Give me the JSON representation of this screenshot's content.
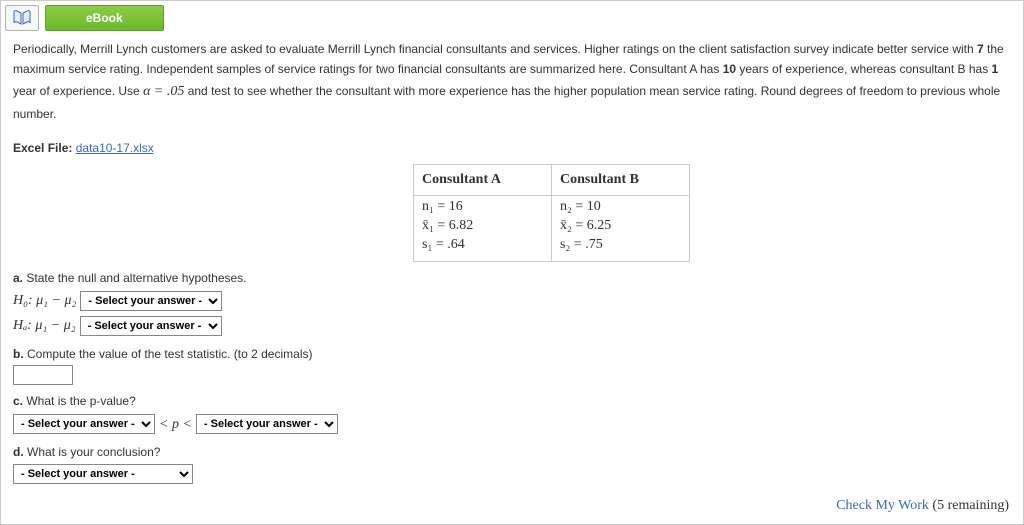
{
  "toolbar": {
    "ebook_label": "eBook"
  },
  "problem": {
    "text_parts": [
      "Periodically, Merrill Lynch customers are asked to evaluate Merrill Lynch financial consultants and services. Higher ratings on the client satisfaction survey indicate better service with ",
      "7",
      " the maximum service rating. Independent samples of service ratings for two financial consultants are summarized here. Consultant A has ",
      "10",
      " years of experience, whereas consultant B has ",
      "1",
      " year of experience. Use ",
      "α = .05",
      " and test to see whether the consultant with more experience has the higher population mean service rating. Round degrees of freedom to previous whole number."
    ],
    "file_label": "Excel File:",
    "file_name": "data10-17.xlsx"
  },
  "table": {
    "header_a": "Consultant A",
    "header_b": "Consultant B",
    "a_n": "n₁ = 16",
    "a_xbar": "x̄₁ = 6.82",
    "a_s": "s₁ = .64",
    "b_n": "n₂ = 10",
    "b_xbar": "x̄₂ = 6.25",
    "b_s": "s₂ = .75"
  },
  "questions": {
    "a_text": "State the null and alternative hypotheses.",
    "h0_prefix": "H₀: μ₁ − μ₂",
    "ha_prefix": "Hₐ: μ₁ − μ₂",
    "b_text": "Compute the value of the test statistic. (to 2 decimals)",
    "c_text": "What is the p-value?",
    "p_between": "< p <",
    "d_text": "What is your conclusion?"
  },
  "controls": {
    "select_placeholder": "- Select your answer -"
  },
  "footer": {
    "check_label": "Check My Work",
    "remaining": "(5 remaining)"
  }
}
